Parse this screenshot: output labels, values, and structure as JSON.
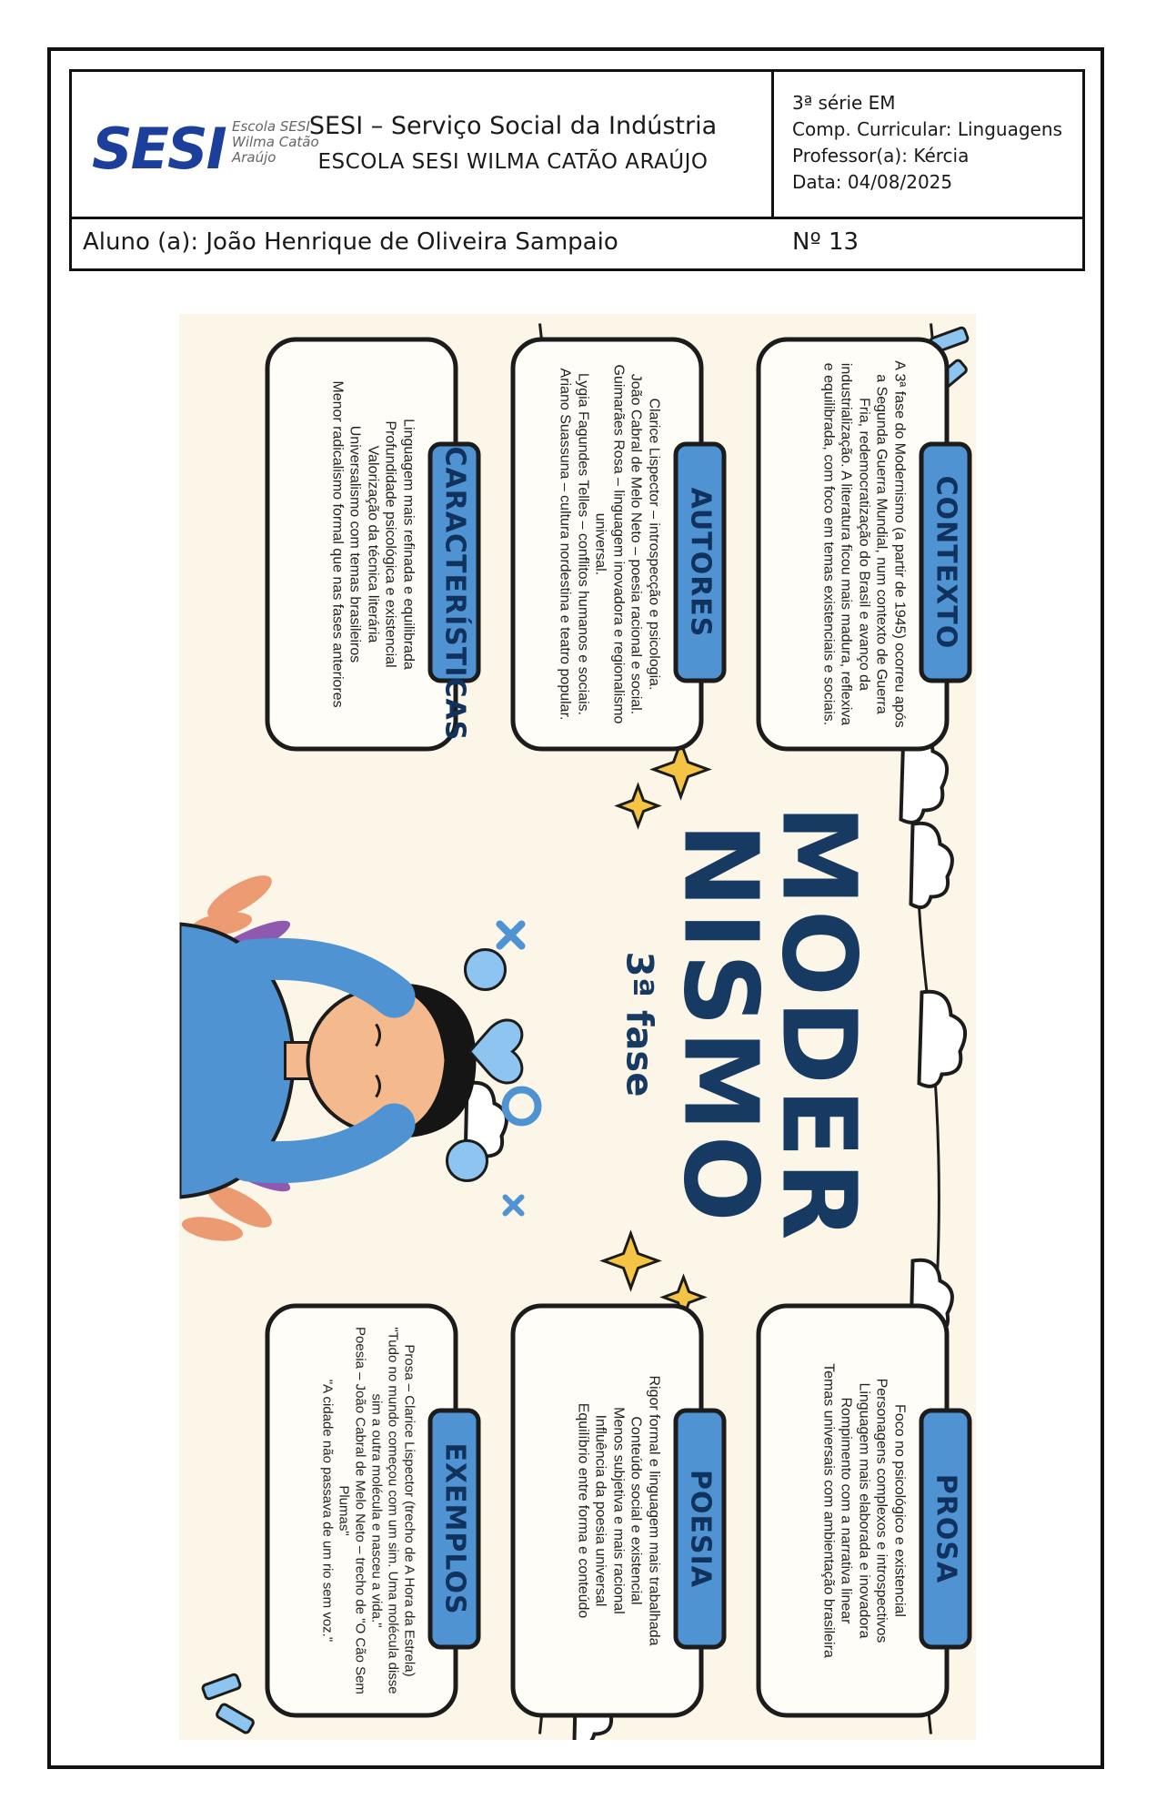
{
  "header": {
    "logo": "SESI",
    "logo_sub": [
      "Escola SESI",
      "Wilma Catão",
      "Araújo"
    ],
    "institution": "SESI – Serviço Social da Indústria",
    "school": "ESCOLA SESI WILMA CATÃO ARAÚJO",
    "grade": "3ª série EM",
    "component": "Comp. Curricular: Linguagens",
    "teacher": "Professor(a): Kércia",
    "date": "Data: 04/08/2025",
    "student": "Aluno (a): João Henrique de Oliveira Sampaio",
    "number": "Nº 13"
  },
  "poster": {
    "title_line1": "MODER",
    "title_line2": "NISMO",
    "subtitle": "3ª fase",
    "contexto": {
      "label": "CONTEXTO",
      "text": "A 3ª fase do Modernismo (a partir de 1945) ocorreu após a Segunda Guerra Mundial, num contexto de Guerra Fria, redemocratização do Brasil e avanço da industrialização. A literatura ficou mais madura, reflexiva e equilibrada, com foco em temas existenciais e sociais."
    },
    "autores": {
      "label": "AUTORES",
      "items": [
        "Clarice Lispector – introspecção e psicologia.",
        "João Cabral de Melo Neto – poesia racional e social.",
        "Guimarães Rosa – linguagem inovadora e regionalismo universal.",
        "Lygia Fagundes Telles – conflitos humanos e sociais.",
        "Ariano Suassuna – cultura nordestina e teatro popular."
      ]
    },
    "caracteristicas": {
      "label": "CARACTERÍSTICAS",
      "items": [
        "Linguagem mais refinada e equilibrada",
        "Profundidade psicológica e existencial",
        "Valorização da técnica literária",
        "Universalismo com temas brasileiros",
        "Menor radicalismo formal que nas fases anteriores"
      ]
    },
    "prosa": {
      "label": "PROSA",
      "items": [
        "Foco no psicológico e existencial",
        "Personagens complexos e introspectivos",
        "Linguagem mais elaborada e inovadora",
        "Rompimento com a narrativa linear",
        "Temas universais com ambientação brasileira"
      ]
    },
    "poesia": {
      "label": "POESIA",
      "items": [
        "Rigor formal e linguagem mais trabalhada",
        "Conteúdo social e existencial",
        "Menos subjetiva e mais racional",
        "Influência da poesia universal",
        "Equilíbrio entre forma e conteúdo"
      ]
    },
    "exemplos": {
      "label": "EXEMPLOS",
      "lines": [
        "Prosa – Clarice Lispector (trecho de A Hora da Estrela)",
        "\"Tudo no mundo começou com um sim. Uma molécula disse sim a outra molécula e nasceu a vida.\"",
        "Poesia – João Cabral de Melo Neto – trecho de \"O Cão Sem Plumas\"",
        "\"A cidade não passava de um rio sem voz.\""
      ]
    }
  }
}
